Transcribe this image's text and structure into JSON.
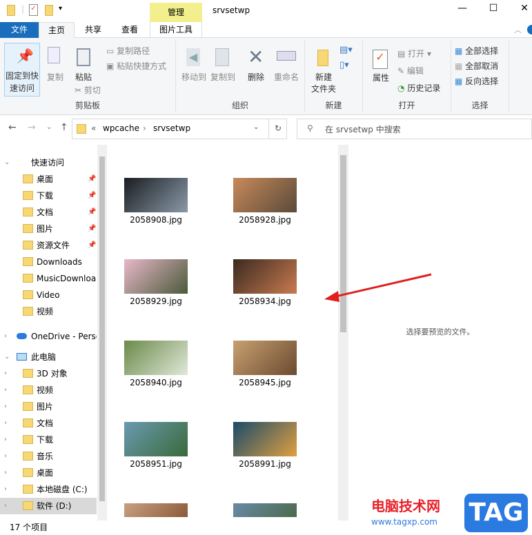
{
  "window": {
    "title": "srvsetwp",
    "context_tab": "管理",
    "context_tab_color": "#f2ef8c"
  },
  "tabs": [
    {
      "label": "文件"
    },
    {
      "label": "主页"
    },
    {
      "label": "共享"
    },
    {
      "label": "查看"
    },
    {
      "label": "图片工具"
    }
  ],
  "ribbon": {
    "clipboard": {
      "label": "剪贴板",
      "pin": "固定到快速访问",
      "pin1": "固定到快",
      "pin2": "速访问",
      "copy": "复制",
      "paste": "粘贴",
      "copy_path": "复制路径",
      "paste_shortcut": "粘贴快捷方式",
      "cut": "剪切"
    },
    "organize": {
      "label": "组织",
      "move_to": "移动到",
      "copy_to": "复制到",
      "delete": "删除",
      "rename": "重命名"
    },
    "new": {
      "label": "新建",
      "new_folder1": "新建",
      "new_folder2": "文件夹"
    },
    "open": {
      "label": "打开",
      "properties": "属性",
      "open": "打开",
      "edit": "编辑",
      "history": "历史记录"
    },
    "select": {
      "label": "选择",
      "select_all": "全部选择",
      "select_none": "全部取消",
      "invert": "反向选择"
    }
  },
  "address": {
    "breadcrumb_prefix": "«",
    "crumbs": [
      "wpcache",
      "srvsetwp"
    ],
    "search_placeholder": "在 srvsetwp 中搜索"
  },
  "nav": {
    "quick_access": "快速访问",
    "quick_items": [
      {
        "label": "桌面",
        "pinned": true
      },
      {
        "label": "下载",
        "pinned": true
      },
      {
        "label": "文档",
        "pinned": true
      },
      {
        "label": "图片",
        "pinned": true
      },
      {
        "label": "资源文件",
        "pinned": true
      },
      {
        "label": "Downloads"
      },
      {
        "label": "MusicDownloa"
      },
      {
        "label": "Video"
      },
      {
        "label": "视频"
      }
    ],
    "onedrive": "OneDrive - Perso",
    "this_pc": "此电脑",
    "pc_items": [
      {
        "label": "3D 对象"
      },
      {
        "label": "视频"
      },
      {
        "label": "图片"
      },
      {
        "label": "文档"
      },
      {
        "label": "下载"
      },
      {
        "label": "音乐"
      },
      {
        "label": "桌面"
      },
      {
        "label": "本地磁盘 (C:)"
      },
      {
        "label": "软件 (D:)"
      }
    ]
  },
  "files": [
    {
      "name": "2058908.jpg",
      "colors": [
        "#1a1d22",
        "#8a9aa8"
      ]
    },
    {
      "name": "2058928.jpg",
      "colors": [
        "#c88a5a",
        "#5a4a3a"
      ]
    },
    {
      "name": "2058929.jpg",
      "colors": [
        "#e8b8c8",
        "#4a5a3a"
      ]
    },
    {
      "name": "2058934.jpg",
      "colors": [
        "#3a2a20",
        "#c87a50"
      ]
    },
    {
      "name": "2058940.jpg",
      "colors": [
        "#6a8a4a",
        "#e0e8d8"
      ]
    },
    {
      "name": "2058945.jpg",
      "colors": [
        "#c8a070",
        "#6a4a30"
      ]
    },
    {
      "name": "2058951.jpg",
      "colors": [
        "#6a9ab0",
        "#3a6a3a"
      ]
    },
    {
      "name": "2058991.jpg",
      "colors": [
        "#1a4a6a",
        "#e0a040"
      ]
    },
    {
      "name": "",
      "colors": [
        "#c8a080",
        "#8a5a3a"
      ]
    },
    {
      "name": "",
      "colors": [
        "#6a8aa8",
        "#4a6a4a"
      ]
    }
  ],
  "preview": {
    "message": "选择要预览的文件。"
  },
  "status": {
    "count": "17 个项目"
  },
  "watermark": {
    "site_cn": "电脑技术网",
    "url": "www.tagxp.com",
    "badge": "TAG"
  }
}
